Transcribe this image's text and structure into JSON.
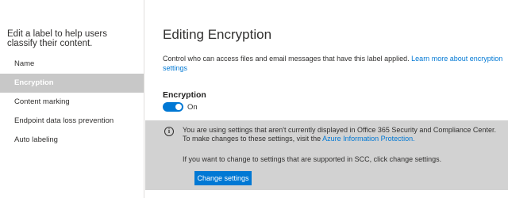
{
  "sidebar": {
    "heading": "Edit a label to help users classify their content.",
    "items": [
      {
        "label": "Name"
      },
      {
        "label": "Encryption",
        "active": true
      },
      {
        "label": "Content marking"
      },
      {
        "label": "Endpoint data loss prevention"
      },
      {
        "label": "Auto labeling"
      }
    ]
  },
  "main": {
    "title": "Editing Encryption",
    "description": "Control who can access files and email messages that have this label applied. ",
    "learn_more_link": "Learn more about encryption settings",
    "encryption_label": "Encryption",
    "toggle_state": "On",
    "notice": {
      "text_before_link": "You are using settings that aren't currently displayed in Office 365 Security and Compliance Center. To make changes to these settings, visit the ",
      "link": "Azure Information Protection.",
      "text2": "If you want to change to settings that are supported in SCC, click change settings.",
      "button_label": "Change settings"
    }
  },
  "colors": {
    "accent": "#0078d4",
    "active_nav_bg": "#c8c8c8",
    "notice_bg": "#d2d2d2"
  },
  "icons": {
    "notice": "info-icon"
  }
}
